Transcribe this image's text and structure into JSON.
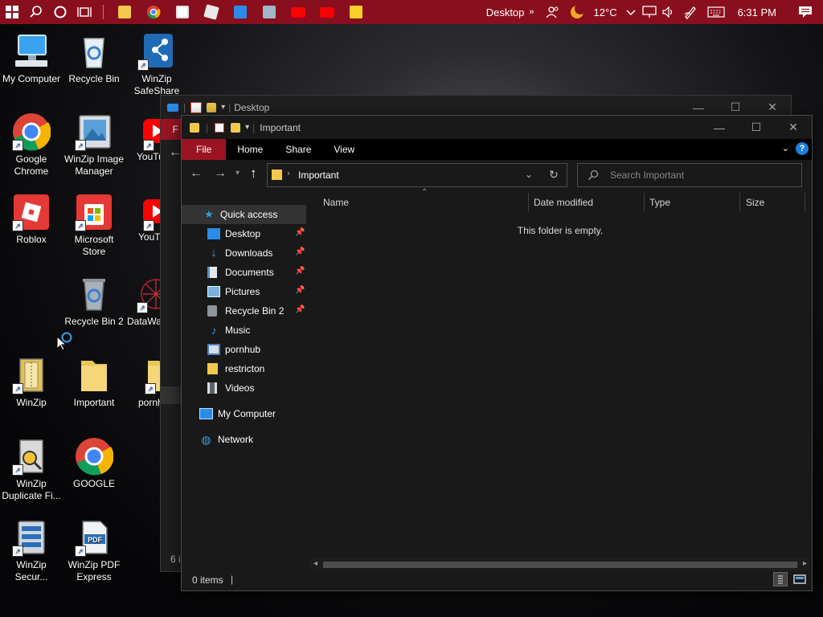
{
  "taskbar": {
    "desktop_label": "Desktop",
    "temperature": "12°C",
    "time": "6:31 PM"
  },
  "desktop_icons": [
    {
      "label": "My Computer"
    },
    {
      "label": "Recycle Bin"
    },
    {
      "label": "WinZip SafeShare"
    },
    {
      "label": "Google Chrome"
    },
    {
      "label": "WinZip Image Manager"
    },
    {
      "label": "YouTub"
    },
    {
      "label": "Roblox"
    },
    {
      "label": "Microsoft Store"
    },
    {
      "label": "YouT"
    },
    {
      "label": "Recycle Bin 2"
    },
    {
      "label": "DataWa"
    },
    {
      "label": "WinZip"
    },
    {
      "label": "Important"
    },
    {
      "label": "pornh"
    },
    {
      "label": "WinZip Duplicate Fi..."
    },
    {
      "label": "GOOGLE"
    },
    {
      "label": "WinZip Secur..."
    },
    {
      "label": "WinZip PDF Express"
    }
  ],
  "back_window": {
    "title": "Desktop",
    "partial_file": "F",
    "status_partial": "6 i"
  },
  "window": {
    "title": "Important",
    "ribbon_tabs": [
      "File",
      "Home",
      "Share",
      "View"
    ],
    "address_path": "Important",
    "search_placeholder": "Search Important",
    "nav": {
      "quick_access": "Quick access",
      "items": [
        {
          "label": "Desktop",
          "pinned": true
        },
        {
          "label": "Downloads",
          "pinned": true
        },
        {
          "label": "Documents",
          "pinned": true
        },
        {
          "label": "Pictures",
          "pinned": true
        },
        {
          "label": "Recycle Bin 2",
          "pinned": true
        },
        {
          "label": "Music",
          "pinned": false
        },
        {
          "label": "pornhub",
          "pinned": false
        },
        {
          "label": "restricton",
          "pinned": false
        },
        {
          "label": "Videos",
          "pinned": false
        }
      ],
      "my_computer": "My Computer",
      "network": "Network"
    },
    "columns": [
      "Name",
      "Date modified",
      "Type",
      "Size"
    ],
    "empty_message": "This folder is empty.",
    "status_items": "0 items"
  }
}
